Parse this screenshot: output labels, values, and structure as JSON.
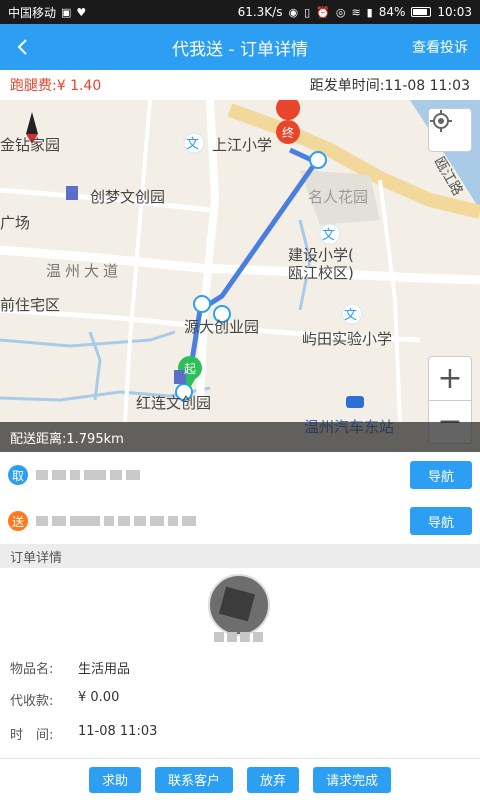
{
  "statusbar": {
    "carrier": "中国移动",
    "net_speed": "61.3K/s",
    "battery": "84%",
    "time": "10:03"
  },
  "header": {
    "title": "代我送 - 订单详情",
    "complain_label": "查看投诉"
  },
  "infobar": {
    "fee": "跑腿费:¥ 1.40",
    "depart_time": "距发单时间:11-08 11:03"
  },
  "map": {
    "start_marker": "起",
    "end_marker": "终",
    "labels": {
      "shangjiang": "上江小学",
      "jindiu": "金钻家园",
      "chuangmeng": "创梦文创园",
      "mingren": "名人花园",
      "jianshe": "建设小学(\n瓯江校区)",
      "wenzhou_dadao": "温州大道",
      "qianzhu": "前住宅区",
      "yuantian": "屿田实验小学",
      "yuanda": "源大创业园",
      "honglian": "红连文创园",
      "bus_station": "温州汽车东站",
      "ou_jiang_road": "瓯江路",
      "chang": "广场"
    },
    "distance": "配送距离:1.795km"
  },
  "pickup": {
    "badge": "取",
    "nav_label": "导航"
  },
  "delivery": {
    "badge": "送",
    "nav_label": "导航"
  },
  "order_detail": {
    "section_title": "订单详情",
    "item_label": "物品名:",
    "item_value": "生活用品",
    "cod_label": "代收款:",
    "cod_value": "¥ 0.00",
    "time_label": "时　间:",
    "time_value": "11-08 11:03"
  },
  "actions": {
    "help": "求助",
    "contact": "联系客户",
    "abandon": "放弃",
    "complete": "请求完成"
  },
  "colors": {
    "brand": "#2d9ff3",
    "fee": "#e8452c",
    "send_badge": "#ff7a1f",
    "route": "#4a7fe0"
  }
}
